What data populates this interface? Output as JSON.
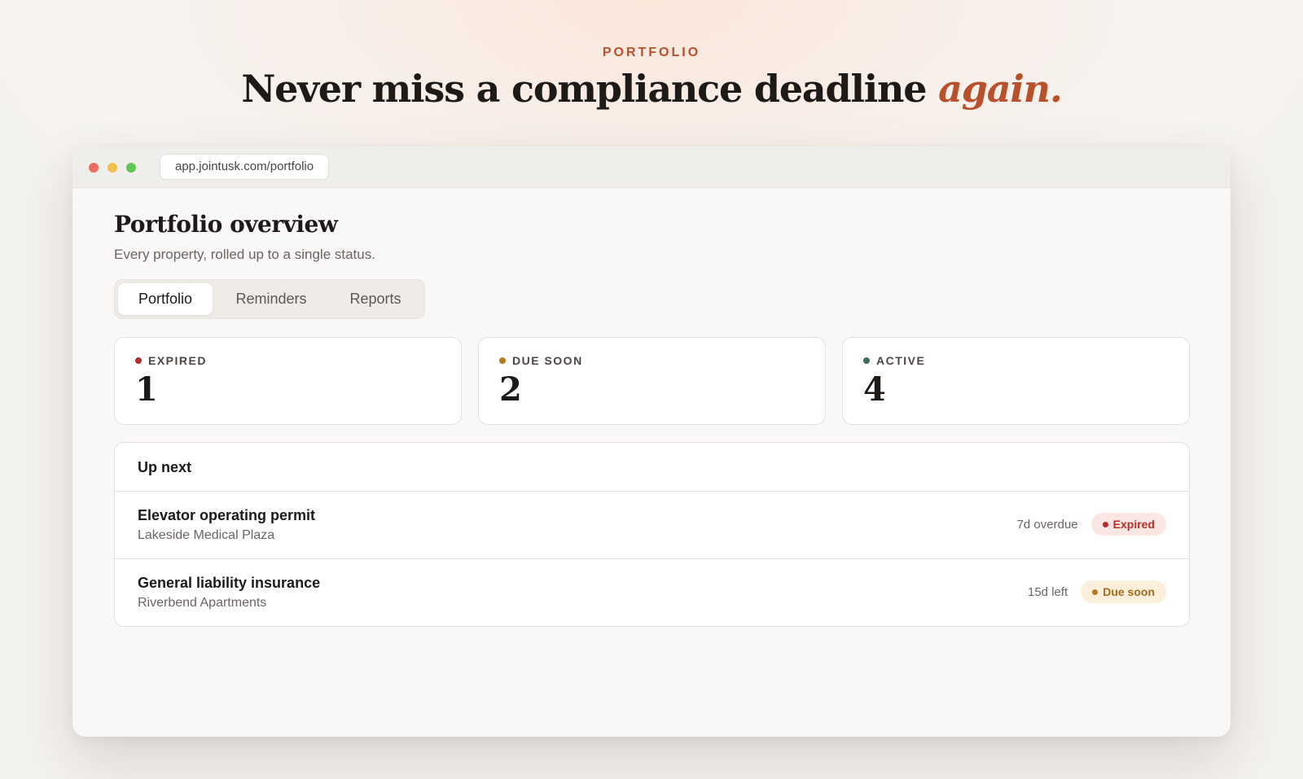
{
  "hero": {
    "eyebrow": "PORTFOLIO",
    "headline": "Never miss a compliance deadline",
    "headline_accent": "again."
  },
  "browser": {
    "url": "app.jointusk.com/portfolio"
  },
  "page": {
    "title": "Portfolio overview",
    "subtitle": "Every property, rolled up to a single status."
  },
  "tabs": [
    {
      "label": "Portfolio",
      "active": true
    },
    {
      "label": "Reminders",
      "active": false
    },
    {
      "label": "Reports",
      "active": false
    }
  ],
  "stats": [
    {
      "label": "EXPIRED",
      "value": "1",
      "color": "#b52f2a"
    },
    {
      "label": "DUE SOON",
      "value": "2",
      "color": "#b9781e"
    },
    {
      "label": "ACTIVE",
      "value": "4",
      "color": "#3f6e5a"
    }
  ],
  "up_next": {
    "title": "Up next",
    "rows": [
      {
        "title": "Elevator operating permit",
        "property": "Lakeside Medical Plaza",
        "time": "7d overdue",
        "status": "Expired"
      },
      {
        "title": "General liability insurance",
        "property": "Riverbend Apartments",
        "time": "15d left",
        "status": "Due soon"
      }
    ]
  },
  "colors": {
    "accent": "#b8502c",
    "expired": "#b52f2a",
    "due_soon": "#b9781e",
    "active": "#3f6e5a"
  }
}
